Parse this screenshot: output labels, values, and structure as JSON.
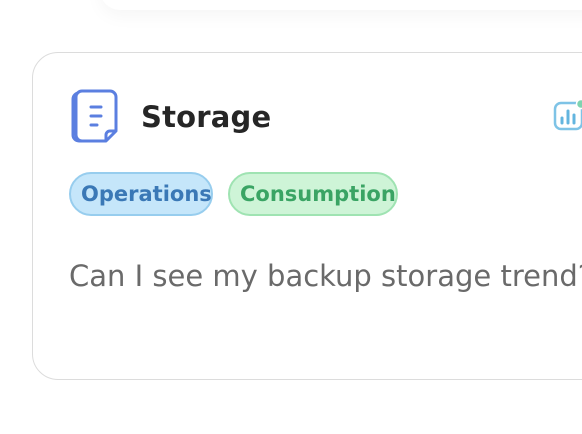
{
  "card": {
    "title": "Storage",
    "tags": [
      {
        "label": "Operations",
        "color": "#3a78b6"
      },
      {
        "label": "Consumption",
        "color": "#3aa464"
      }
    ],
    "question": "Can I see my backup storage trend?",
    "icons": {
      "leading": "document-icon",
      "trailing": "chart-insight-icon"
    }
  }
}
